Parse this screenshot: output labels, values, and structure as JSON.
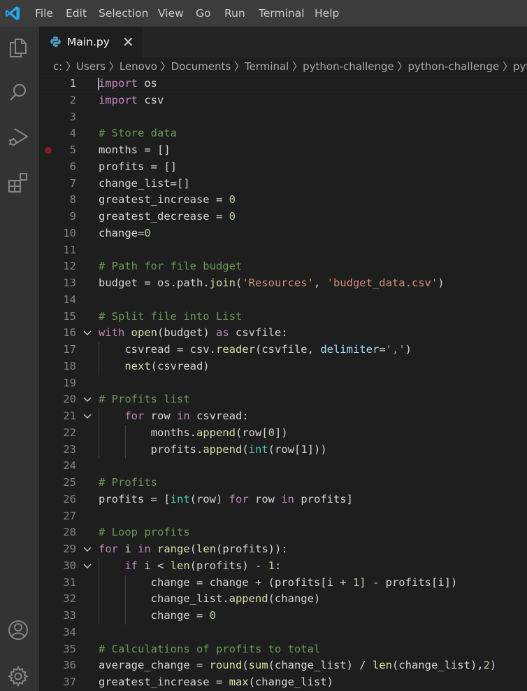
{
  "menu": [
    "File",
    "Edit",
    "Selection",
    "View",
    "Go",
    "Run",
    "Terminal",
    "Help"
  ],
  "tab": {
    "title": "Main.py",
    "close": "✕"
  },
  "breadcrumb": "c: 〉Users 〉Lenovo 〉Documents 〉Terminal 〉python-challenge 〉python-challenge 〉python",
  "editor": {
    "current_line": 1,
    "breakpoint_line": 5,
    "folded_lines": [
      16,
      20,
      21,
      29,
      30
    ],
    "lines": [
      "import os",
      "import csv",
      "",
      "# Store data",
      "months = []",
      "profits = []",
      "change_list=[]",
      "greatest_increase = 0",
      "greatest_decrease = 0",
      "change=0",
      "",
      "# Path for file budget",
      "budget = os.path.join('Resources', 'budget_data.csv')",
      "",
      "# Split file into List",
      "with open(budget) as csvfile:",
      "    csvread = csv.reader(csvfile, delimiter=',')",
      "    next(csvread)",
      "",
      "# Profits list",
      "    for row in csvread:",
      "        months.append(row[0])",
      "        profits.append(int(row[1]))",
      "",
      "# Profits",
      "profits = [int(row) for row in profits]",
      "",
      "# Loop profits",
      "for i in range(len(profits)):",
      "    if i < len(profits) - 1:",
      "        change = change + (profits[i + 1] - profits[i])",
      "        change_list.append(change)",
      "        change = 0",
      "",
      "# Calculations of profits to total",
      "average_change = round(sum(change_list) / len(change_list),2)",
      "greatest_increase = max(change_list)"
    ]
  },
  "colors": {
    "keyword": "#c586c0",
    "keyword_blue": "#569cd6",
    "function": "#dcdcaa",
    "type": "#4ec9b0",
    "string": "#ce9178",
    "number": "#b5cea8",
    "comment": "#6a9955",
    "param": "#9cdcfe",
    "text": "#d4d4d4"
  },
  "icons": {
    "logo": "vscode-logo-icon",
    "activity": [
      "files-icon",
      "search-icon",
      "run-debug-icon",
      "extensions-icon",
      "account-icon",
      "settings-gear-icon"
    ]
  }
}
